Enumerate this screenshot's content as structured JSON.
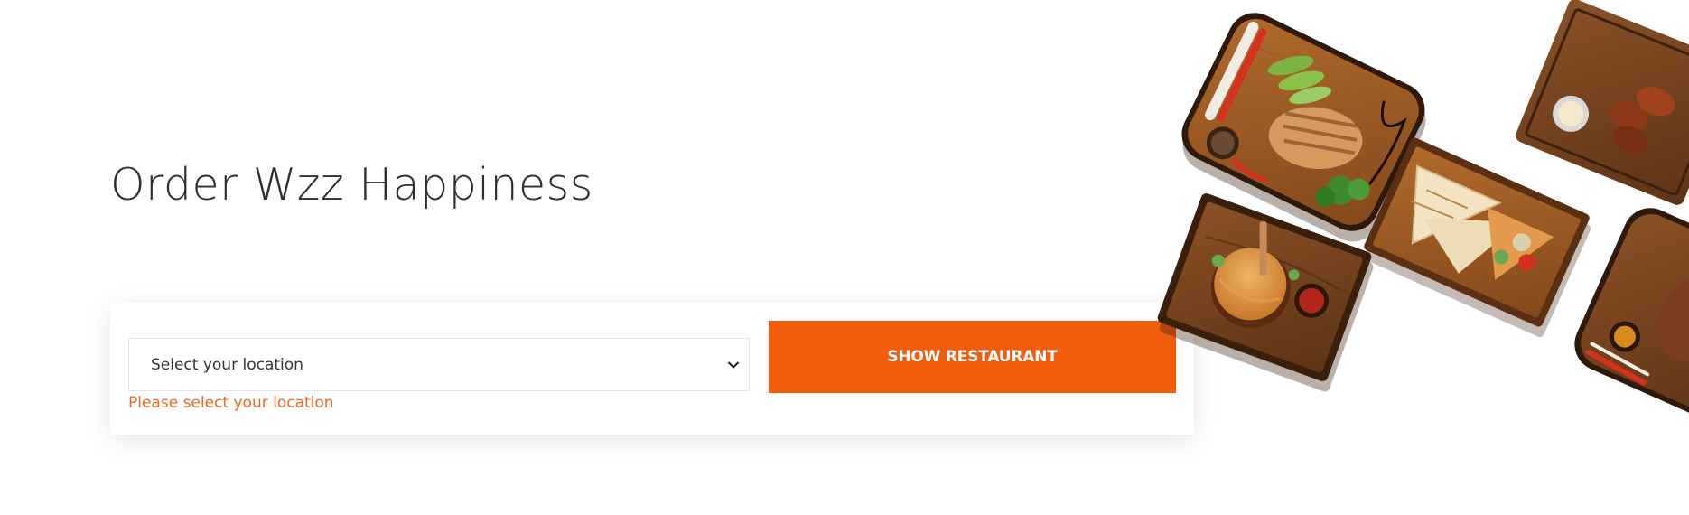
{
  "hero": {
    "title": "Order Wzz Happiness"
  },
  "search": {
    "location_select": {
      "selected_value": "Select your location",
      "icon": "chevron-down-icon"
    },
    "error_message": "Please select your location",
    "submit_label": "SHOW RESTAURANT"
  },
  "colors": {
    "accent": "#f25c0d",
    "error": "#ee6a23",
    "title": "#2e2e2e",
    "board_wood": "#9a5a25"
  }
}
